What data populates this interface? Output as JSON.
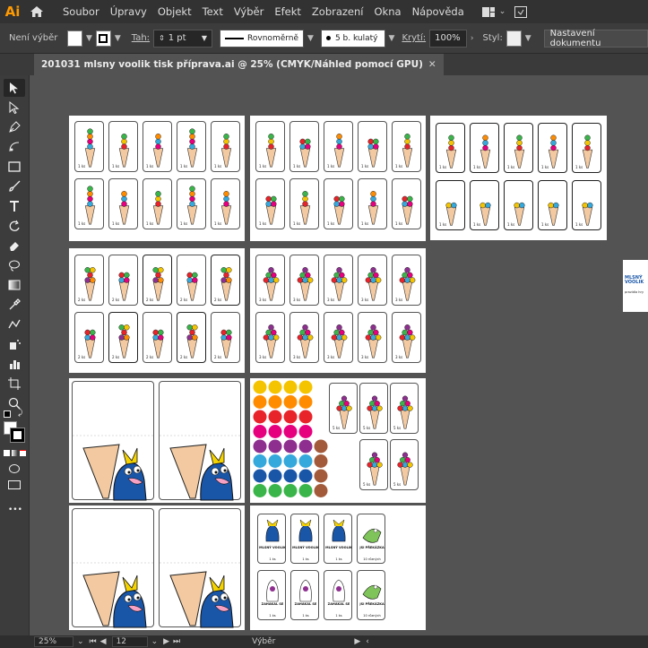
{
  "app": {
    "logo": "Ai",
    "accent": "#ff9a00"
  },
  "menu": {
    "items": [
      "Soubor",
      "Úpravy",
      "Objekt",
      "Text",
      "Výběr",
      "Efekt",
      "Zobrazení",
      "Okna",
      "Nápověda"
    ]
  },
  "control": {
    "selection_label": "Není výběr",
    "stroke_label": "Tah:",
    "stroke_value": "1 pt",
    "profile_label": "Rovnoměrně",
    "brush_label": "5 b. kulatý",
    "opacity_label": "Krytí:",
    "opacity_value": "100%",
    "style_label": "Styl:",
    "doc_settings_label": "Nastavení dokumentu"
  },
  "document": {
    "tab_title": "201031 mlsny voolik tisk příprava.ai @ 25% (CMYK/Náhled pomocí GPU)",
    "close_glyph": "✕"
  },
  "toolbar": {
    "tools": [
      "selection-tool",
      "direct-selection-tool",
      "pen-tool",
      "curvature-tool",
      "rectangle-tool",
      "paintbrush-tool",
      "type-tool",
      "rotate-tool",
      "eraser-tool",
      "lasso-tool",
      "gradient-tool",
      "eyedropper-tool",
      "blend-tool",
      "symbol-sprayer-tool",
      "artboard-tool",
      "slice-tool",
      "zoom-tool"
    ],
    "more_glyph": "•••"
  },
  "artwork": {
    "palette": [
      "#f5c400",
      "#ff8c00",
      "#e8232a",
      "#e6007e",
      "#8e2f8f",
      "#35a8dc",
      "#1a56a8",
      "#3ab54a",
      "#a35a3a",
      "#f9e64f"
    ],
    "card_number_labels": [
      "1 ks",
      "2 ks",
      "3 ks",
      "5 ks"
    ],
    "side_logo_text": "MLSNÝ VOOLIK",
    "side_logo_sub": "pravidla hry",
    "char_card_titles": [
      "MLSNÝ VOOLIK",
      "ZAHAKAL SE",
      "JSI PŘEKÁZKA"
    ],
    "char_card_counts": [
      "1 ks",
      "10 různých"
    ]
  },
  "status": {
    "zoom": "25%",
    "artboard_number": "12",
    "tool_label": "Výběr"
  }
}
